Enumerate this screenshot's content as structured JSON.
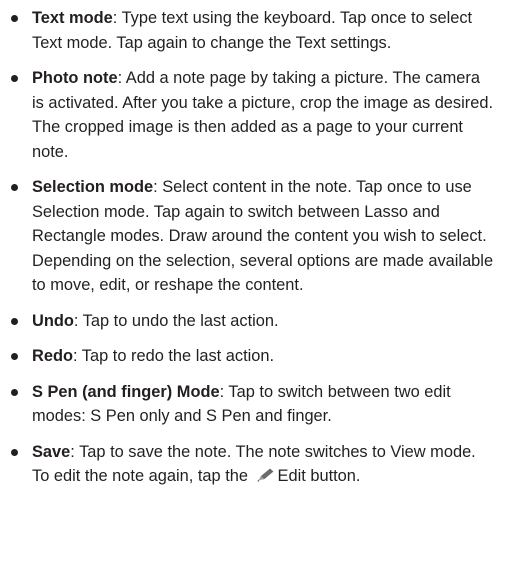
{
  "items": [
    {
      "term": "Text mode",
      "description": ": Type text using the keyboard. Tap once to select Text mode. Tap again to change the Text settings."
    },
    {
      "term": "Photo note",
      "description": ": Add a note page by taking a picture. The camera is activated. After you take a picture, crop the image as desired. The cropped image is then added as a page to your current note."
    },
    {
      "term": "Selection mode",
      "description": ": Select content in the note. Tap once to use Selection mode. Tap again to switch between Lasso and Rectangle modes. Draw around the content you wish to select. Depending on the selection, several options are made available to move, edit, or reshape the content."
    },
    {
      "term": "Undo",
      "description": ": Tap to undo the last action."
    },
    {
      "term": "Redo",
      "description": ": Tap to redo the last action."
    },
    {
      "term": "S Pen (and finger) Mode",
      "description": ": Tap to switch between two edit modes: S Pen only and S Pen and finger."
    },
    {
      "term": "Save",
      "description_before_icon": ": Tap to save the note. The note switches to View mode. To edit the note again, tap the",
      "icon": "pencil-edit-icon",
      "description_after_icon": "Edit button."
    }
  ],
  "colors": {
    "text": "#231f20",
    "icon": "#6a6a6a"
  }
}
